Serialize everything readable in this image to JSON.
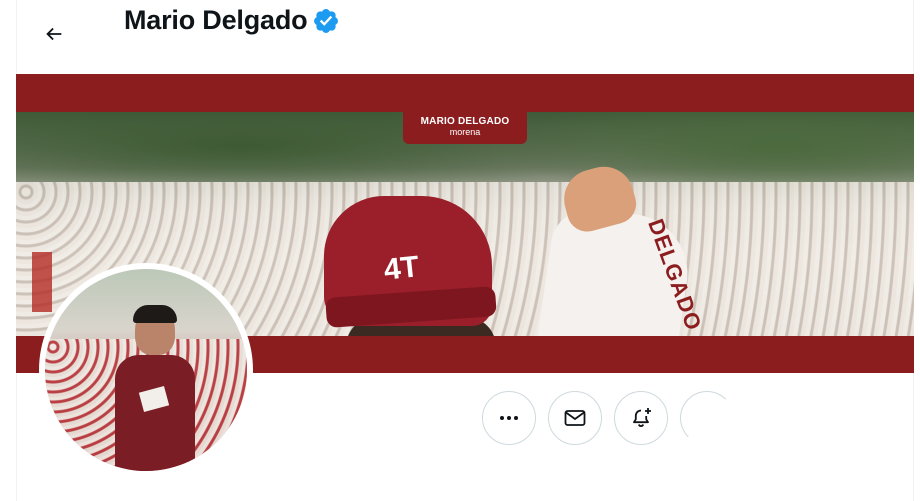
{
  "header": {
    "back_icon": "arrow-left-icon",
    "name": "Mario Delgado",
    "verified_icon": "verified-badge-icon"
  },
  "banner": {
    "tag_name": "MARIO DELGADO",
    "tag_party": "morena",
    "cap_text": "4T",
    "sleeve_text": "DELGADO"
  },
  "actions": {
    "more_icon": "more-dots-icon",
    "message_icon": "envelope-icon",
    "notify_icon": "bell-plus-icon"
  },
  "colors": {
    "brand_red": "#8c1d1f",
    "verified_blue": "#1d9bf0",
    "text_primary": "#0f1419",
    "border": "#cfd9de"
  }
}
